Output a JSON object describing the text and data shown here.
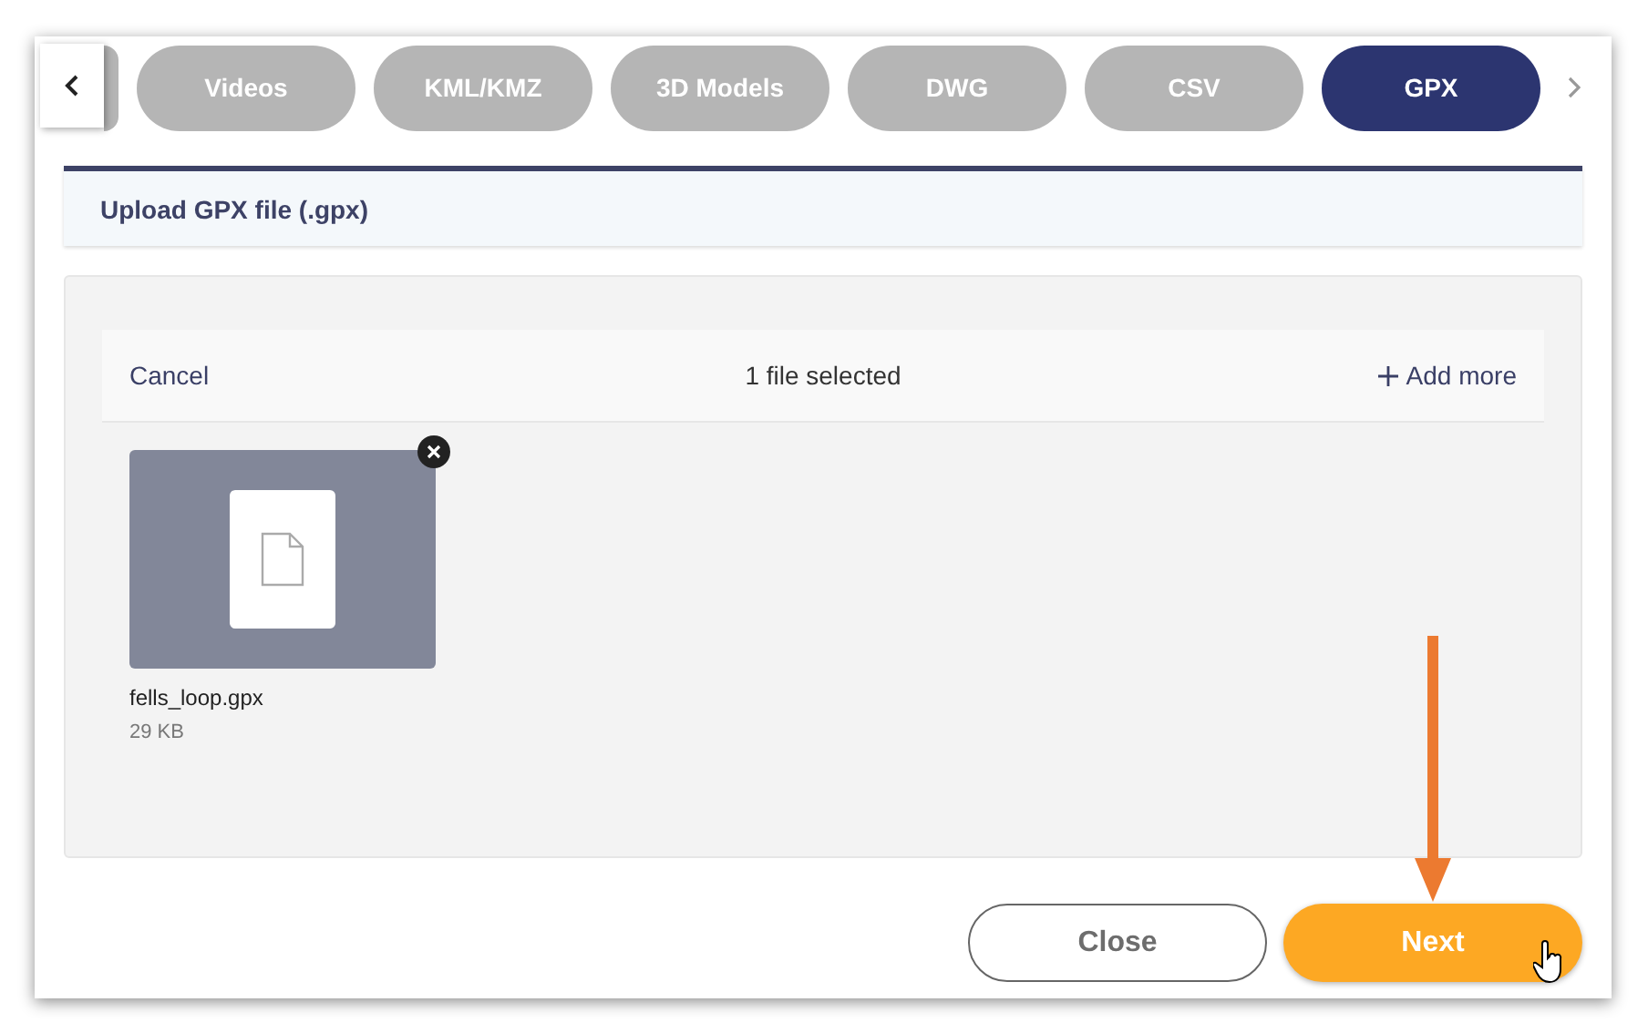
{
  "tabs": [
    {
      "label": "Videos",
      "selected": false
    },
    {
      "label": "KML/KMZ",
      "selected": false
    },
    {
      "label": "3D Models",
      "selected": false
    },
    {
      "label": "DWG",
      "selected": false
    },
    {
      "label": "CSV",
      "selected": false
    },
    {
      "label": "GPX",
      "selected": true
    }
  ],
  "section_title": "Upload GPX file (.gpx)",
  "uploader": {
    "cancel": "Cancel",
    "status": "1 file selected",
    "add_more": "Add more",
    "files": [
      {
        "name": "fells_loop.gpx",
        "size": "29 KB"
      }
    ]
  },
  "buttons": {
    "close": "Close",
    "next": "Next"
  }
}
